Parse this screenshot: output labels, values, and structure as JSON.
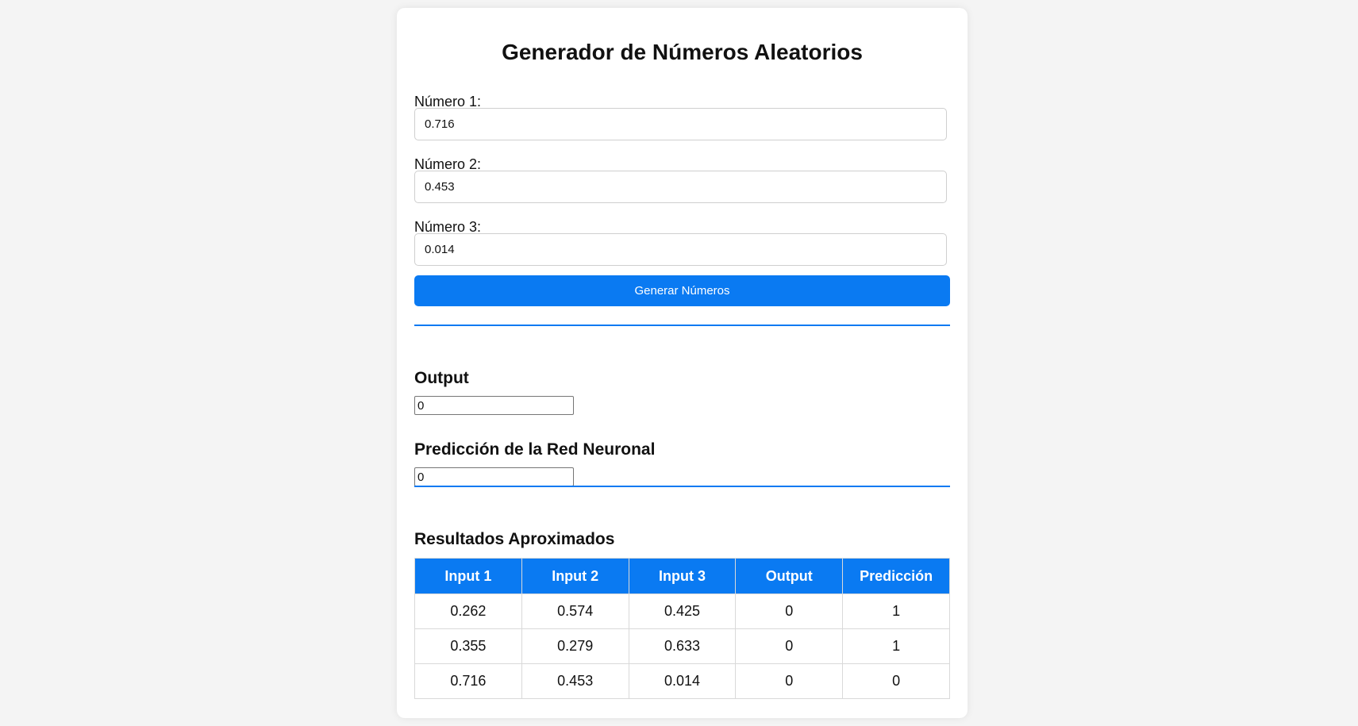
{
  "title": "Generador de Números Aleatorios",
  "fields": [
    {
      "label": "Número 1:",
      "value": "0.716"
    },
    {
      "label": "Número 2:",
      "value": "0.453"
    },
    {
      "label": "Número 3:",
      "value": "0.014"
    }
  ],
  "generate_button": "Generar Números",
  "output": {
    "title": "Output",
    "value": "0"
  },
  "prediction": {
    "title": "Predicción de la Red Neuronal",
    "value": "0"
  },
  "results": {
    "title": "Resultados Aproximados",
    "headers": [
      "Input 1",
      "Input 2",
      "Input 3",
      "Output",
      "Predicción"
    ],
    "rows": [
      [
        "0.262",
        "0.574",
        "0.425",
        "0",
        "1"
      ],
      [
        "0.355",
        "0.279",
        "0.633",
        "0",
        "1"
      ],
      [
        "0.716",
        "0.453",
        "0.014",
        "0",
        "0"
      ]
    ]
  },
  "colors": {
    "accent": "#0a7af2",
    "background": "#f4f4f4",
    "card": "#ffffff"
  }
}
